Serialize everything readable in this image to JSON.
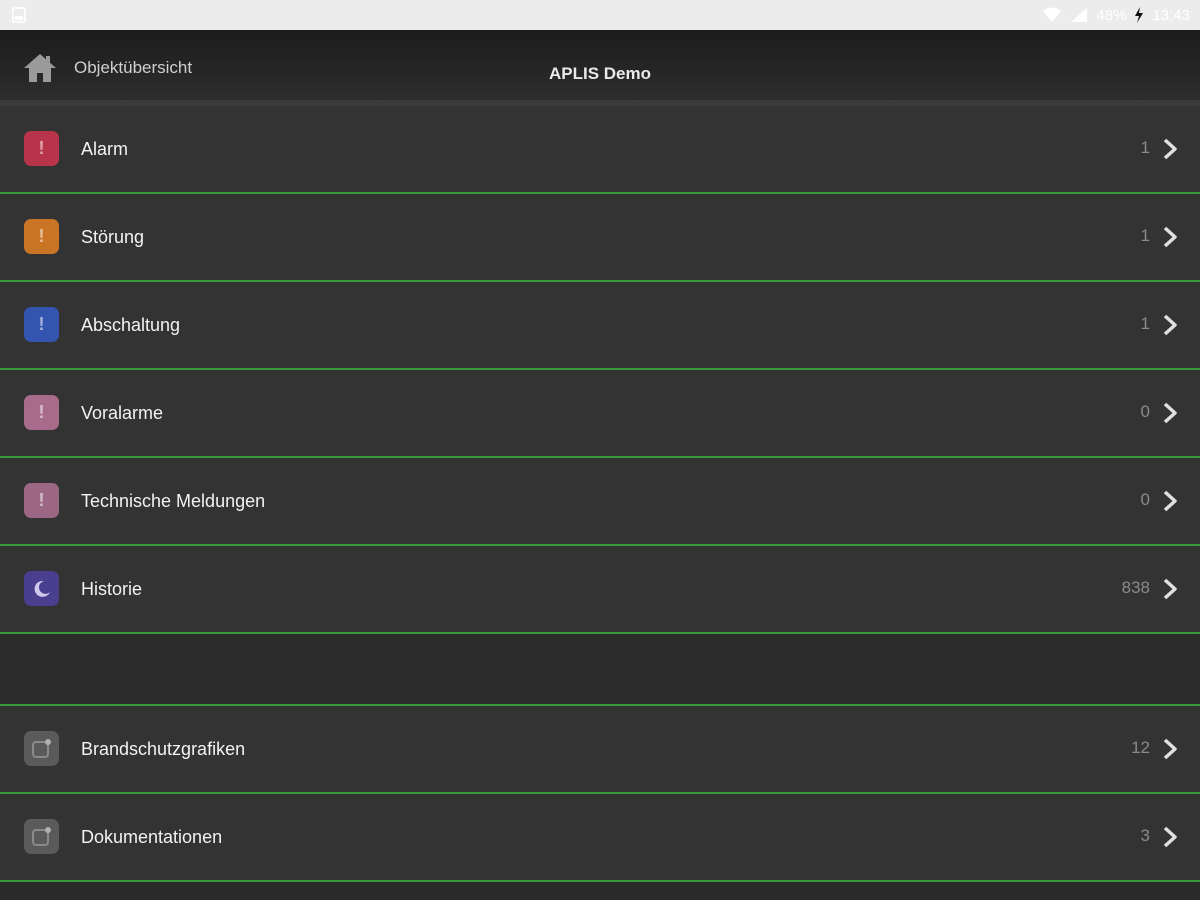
{
  "status_bar": {
    "battery_percent": "48%",
    "time": "13:43",
    "icons": [
      "image-icon",
      "wifi-icon",
      "signal-icon",
      "charging-icon"
    ]
  },
  "header": {
    "home_label": "Objektübersicht",
    "title": "APLIS Demo"
  },
  "colors": {
    "alarm": "#b8344b",
    "stoerung": "#c97525",
    "abschaltung": "#3355b0",
    "voralarm": "#a86b8c",
    "technisch": "#9c6784",
    "historie": "#4a3f8e",
    "document": "#5a5a5a",
    "separator": "#3a9a3a"
  },
  "list": {
    "items": [
      {
        "label": "Alarm",
        "count": "1",
        "icon": "alarm-exclamation-icon"
      },
      {
        "label": "Störung",
        "count": "1",
        "icon": "stoerung-exclamation-icon"
      },
      {
        "label": "Abschaltung",
        "count": "1",
        "icon": "abschaltung-exclamation-icon"
      },
      {
        "label": "Voralarme",
        "count": "0",
        "icon": "voralarm-exclamation-icon"
      },
      {
        "label": "Technische Meldungen",
        "count": "0",
        "icon": "technisch-exclamation-icon"
      },
      {
        "label": "Historie",
        "count": "838",
        "icon": "moon-icon"
      }
    ],
    "secondary": [
      {
        "label": "Brandschutzgrafiken",
        "count": "12",
        "icon": "graphic-icon"
      },
      {
        "label": "Dokumentationen",
        "count": "3",
        "icon": "document-icon"
      }
    ]
  }
}
